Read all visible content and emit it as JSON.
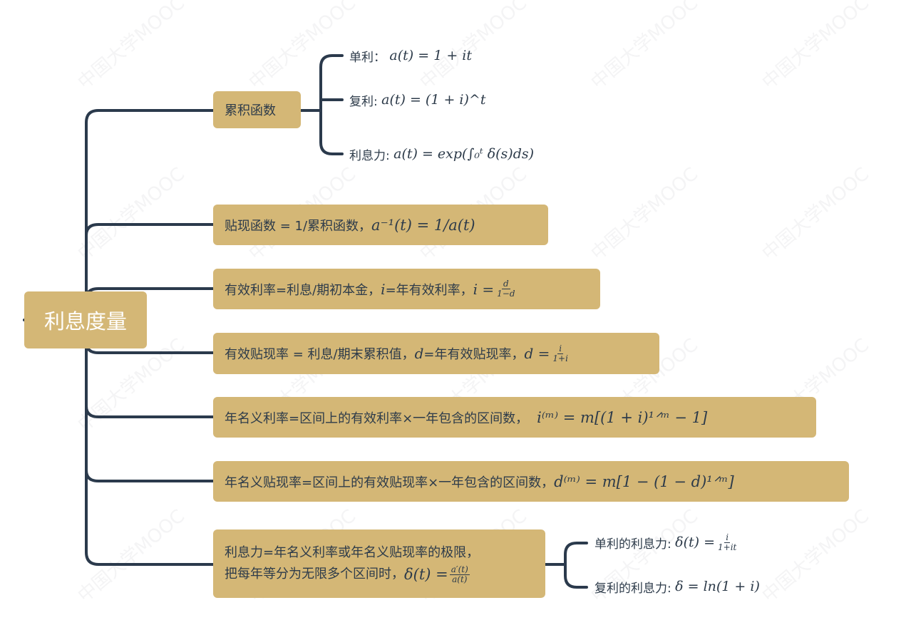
{
  "root": "利息度量",
  "watermark": "中国大学MOOC",
  "accumulation": {
    "label": "累积函数",
    "simple_label": "单利：",
    "simple_formula": "a(t) = 1 + it",
    "compound_label": "复利:",
    "compound_formula": "a(t) = (1 + i)^t",
    "force_label": "利息力:",
    "force_formula": "a(t) = exp(∫₀ᵗ δ(s)ds)"
  },
  "discount_fn": {
    "text": "贴现函数 = 1/累积函数，",
    "formula": "a⁻¹(t) = 1/a(t)"
  },
  "effective_rate": {
    "text": "有效利率=利息/期初本金，",
    "formula_a": "i",
    "text2": "=年有效利率，",
    "formula_b": "i =",
    "num": "d",
    "den": "1−d"
  },
  "effective_discount": {
    "text": "有效贴现率 = 利息/期末累积值，",
    "formula_a": "d",
    "text2": "=年有效贴现率，",
    "formula_b": "d =",
    "num": "i",
    "den": "1+i"
  },
  "nominal_rate": {
    "text": "年名义利率=区间上的有效利率×一年包含的区间数，",
    "formula": "i⁽ᵐ⁾ = m[(1 + i)¹ᐟᵐ − 1]"
  },
  "nominal_discount": {
    "text": "年名义贴现率=区间上的有效贴现率×一年包含的区间数，",
    "formula": "d⁽ᵐ⁾ = m[1 − (1 − d)¹ᐟᵐ]"
  },
  "force": {
    "line1": "利息力=年名义利率或年名义贴现率的极限，",
    "line2": "把每年等分为无限多个区间时，",
    "formula_a": "δ(t) =",
    "num": "a′(t)",
    "den": "a(t)",
    "simple_label": "单利的利息力:",
    "simple_formula": "δ(t) =",
    "simple_num": "i",
    "simple_den": "1+it",
    "compound_label": "复利的利息力:",
    "compound_formula": "δ = ln(1 + i)"
  }
}
